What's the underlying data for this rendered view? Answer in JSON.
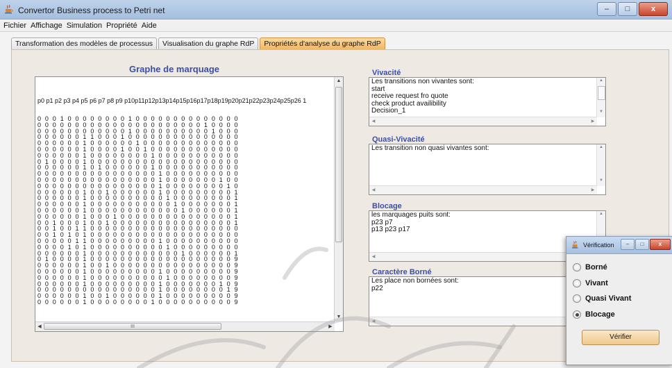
{
  "window": {
    "title": "Convertor Business process to Petri net",
    "controls": [
      "minimize-icon",
      "maximize-icon",
      "close-icon"
    ]
  },
  "menu": [
    "Fichier",
    "Affichage",
    "Simulation",
    "Propriété",
    "Aide"
  ],
  "tabs": [
    {
      "label": "Transformation des modèles de processus",
      "active": false
    },
    {
      "label": "Visualisation du graphe RdP",
      "active": false
    },
    {
      "label": "Propriétés d'analyse du graphe RdP",
      "active": true
    }
  ],
  "graph": {
    "title": "Graphe de marquage",
    "header": "p0 p1 p2 p3 p4 p5 p6 p7 p8 p9 p10p11p12p13p14p15p16p17p18p19p20p21p22p23p24p25p26 1",
    "rows": [
      "0 0 0 1 0 0 0 0 0 0 0 0 1 0 0 0 0 0 0 0 0 0 0 0 0 0 0",
      "0 0 0 0 0 0 0 0 0 0 0 0 0 0 0 0 0 0 0 0 0 0 1 0 0 0 0",
      "0 0 0 0 0 0 0 0 0 0 0 0 1 0 0 0 0 0 0 0 0 0 0 1 0 0 0",
      "0 0 0 0 0 0 1 1 0 0 0 1 0 0 0 0 0 0 0 0 0 0 0 0 0 0 0",
      "0 0 0 0 0 0 1 0 0 0 0 0 0 1 0 0 0 0 0 0 0 0 0 0 0 0 0",
      "0 0 0 0 0 0 1 0 0 0 0 1 0 0 1 0 0 0 0 0 0 0 0 0 0 0 0",
      "0 0 0 0 0 0 1 0 0 0 0 0 0 0 0 1 0 0 0 0 0 0 0 0 0 0 0",
      "0 1 0 0 0 0 1 0 0 0 0 0 0 0 0 0 0 0 0 0 0 0 0 0 0 0 0",
      "0 0 0 0 0 0 1 0 1 0 0 0 0 0 0 1 0 0 0 0 0 0 0 0 0 0 0",
      "0 0 0 0 0 0 0 0 0 0 0 0 0 0 0 0 1 0 0 0 0 0 0 0 0 0 0",
      "0 0 0 0 0 0 0 0 0 0 0 0 0 0 0 0 1 0 0 0 0 0 0 0 1 0 0",
      "0 0 0 0 0 0 0 0 0 0 0 0 0 0 0 0 1 0 0 0 0 0 0 0 0 1 0",
      "0 0 0 0 0 0 1 0 0 1 0 0 0 0 0 0 1 0 0 0 0 0 0 0 0 0 1",
      "0 0 0 0 0 0 1 0 0 0 0 0 0 0 0 0 0 1 0 0 0 0 0 0 0 0 1",
      "0 0 0 0 0 0 1 0 0 0 0 0 0 0 0 0 0 0 1 0 0 0 0 0 0 0 1",
      "0 0 0 0 0 0 1 0 0 0 0 0 0 0 0 0 0 0 0 1 0 0 0 0 0 0 1",
      "0 0 0 0 0 0 1 0 0 0 1 0 0 0 0 0 0 0 0 0 0 0 0 0 0 0 1",
      "0 0 1 0 0 0 1 0 0 1 0 0 0 0 0 0 0 0 0 0 0 0 0 0 0 0 1",
      "0 0 1 0 0 1 1 0 0 0 0 0 0 0 0 0 0 0 0 0 0 0 0 0 0 0 0",
      "0 0 1 0 1 0 1 0 0 0 0 0 0 0 0 0 0 0 0 0 0 0 0 0 0 0 0",
      "0 0 0 0 0 1 1 0 0 0 0 0 0 0 0 0 1 0 0 0 0 0 0 0 0 0 0",
      "0 0 0 0 1 0 1 0 0 0 0 0 0 0 0 0 0 1 0 0 0 0 0 0 0 0 0",
      "0 0 0 0 0 0 1 0 0 0 0 0 0 0 0 0 0 0 0 1 0 0 0 0 0 0 1",
      "0 1 0 0 0 0 1 0 0 0 0 0 0 0 0 0 0 0 0 0 0 0 0 0 0 0 9",
      "0 0 0 0 0 0 1 0 0 1 0 0 0 0 0 0 0 0 0 0 0 0 0 0 0 0 9",
      "0 0 0 0 0 0 1 0 0 0 0 0 0 0 0 0 1 0 0 0 0 0 0 0 0 0 9",
      "0 0 0 0 0 0 1 0 0 0 0 0 0 0 0 0 0 1 0 0 0 0 0 0 0 0 9",
      "0 0 0 0 0 0 1 0 0 0 0 0 0 0 0 0 1 0 0 0 0 0 0 0 1 0 9",
      "0 0 0 0 0 0 0 0 0 0 0 0 0 0 0 0 1 0 0 0 0 0 0 0 0 1 9",
      "0 0 0 0 0 0 1 0 0 1 0 0 0 0 0 0 1 0 0 0 0 0 0 0 0 0 9",
      "0 0 0 0 0 0 1 0 0 0 0 0 0 0 0 1 0 0 0 0 0 0 0 0 0 0 9"
    ],
    "hscroll_mark": "III"
  },
  "sections": {
    "vivacite": {
      "title": "Vivacité",
      "lines": [
        "Les transitions non vivantes sont:",
        "start",
        "receive request  fro quote",
        "check product availibility",
        "Decision_1"
      ]
    },
    "quasi": {
      "title": "Quasi-Vivacité",
      "lines": [
        "Les transition non quasi vivantes sont:"
      ]
    },
    "blocage": {
      "title": "Blocage",
      "lines": [
        "les marquages puits sont:",
        "p23 p7",
        "p13 p23 p17"
      ]
    },
    "borne": {
      "title": "Caractère Borné",
      "lines": [
        "Les place non bornées sont:",
        "p22"
      ]
    }
  },
  "dialog": {
    "title": "Vérification",
    "options": [
      {
        "label": "Borné",
        "selected": false
      },
      {
        "label": "Vivant",
        "selected": false
      },
      {
        "label": "Quasi Vivant",
        "selected": false
      },
      {
        "label": "Blocage",
        "selected": true
      }
    ],
    "button": "Vérifier"
  }
}
